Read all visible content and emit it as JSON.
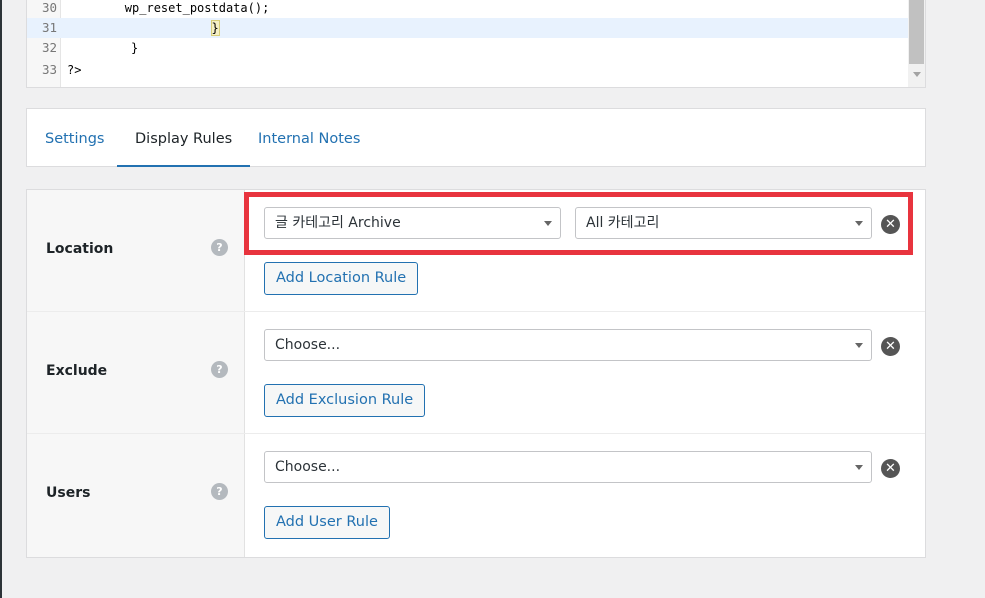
{
  "editor": {
    "lines": [
      {
        "num": "30",
        "code": "        wp_reset_postdata();"
      },
      {
        "num": "31",
        "code": "    }"
      },
      {
        "num": "32",
        "code": "}"
      },
      {
        "num": "33",
        "code": "?>"
      }
    ]
  },
  "tabs": [
    {
      "label": "Settings"
    },
    {
      "label": "Display Rules"
    },
    {
      "label": "Internal Notes"
    }
  ],
  "rules": {
    "location": {
      "label": "Location",
      "help": "?",
      "select_primary": "글 카테고리 Archive",
      "select_secondary": "All 카테고리",
      "add_label": "Add Location Rule"
    },
    "exclude": {
      "label": "Exclude",
      "help": "?",
      "select_primary": "Choose...",
      "add_label": "Add Exclusion Rule"
    },
    "users": {
      "label": "Users",
      "help": "?",
      "select_primary": "Choose...",
      "add_label": "Add User Rule"
    }
  },
  "colors": {
    "accent": "#2271b1",
    "highlight": "#e8343e"
  }
}
